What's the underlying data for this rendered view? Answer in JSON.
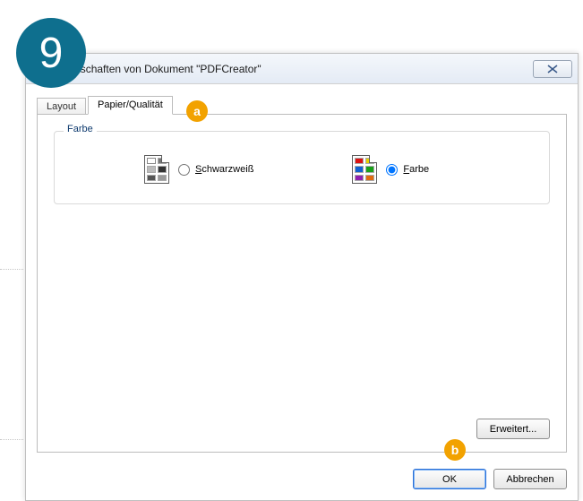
{
  "step_number": "9",
  "annotations": {
    "a": "a",
    "b": "b"
  },
  "dialog": {
    "title": "Eigenschaften von Dokument \"PDFCreator\"",
    "tabs": {
      "layout": "Layout",
      "paper": "Papier/Qualität"
    },
    "group": {
      "title": "Farbe",
      "options": {
        "bw": {
          "label": "Schwarzweiß",
          "underline": "S",
          "rest": "chwarzweiß",
          "selected": false
        },
        "color": {
          "label": "Farbe",
          "underline": "F",
          "rest": "arbe",
          "selected": true
        }
      }
    },
    "buttons": {
      "advanced": "Erweitert...",
      "ok": "OK",
      "cancel": "Abbrechen"
    }
  }
}
